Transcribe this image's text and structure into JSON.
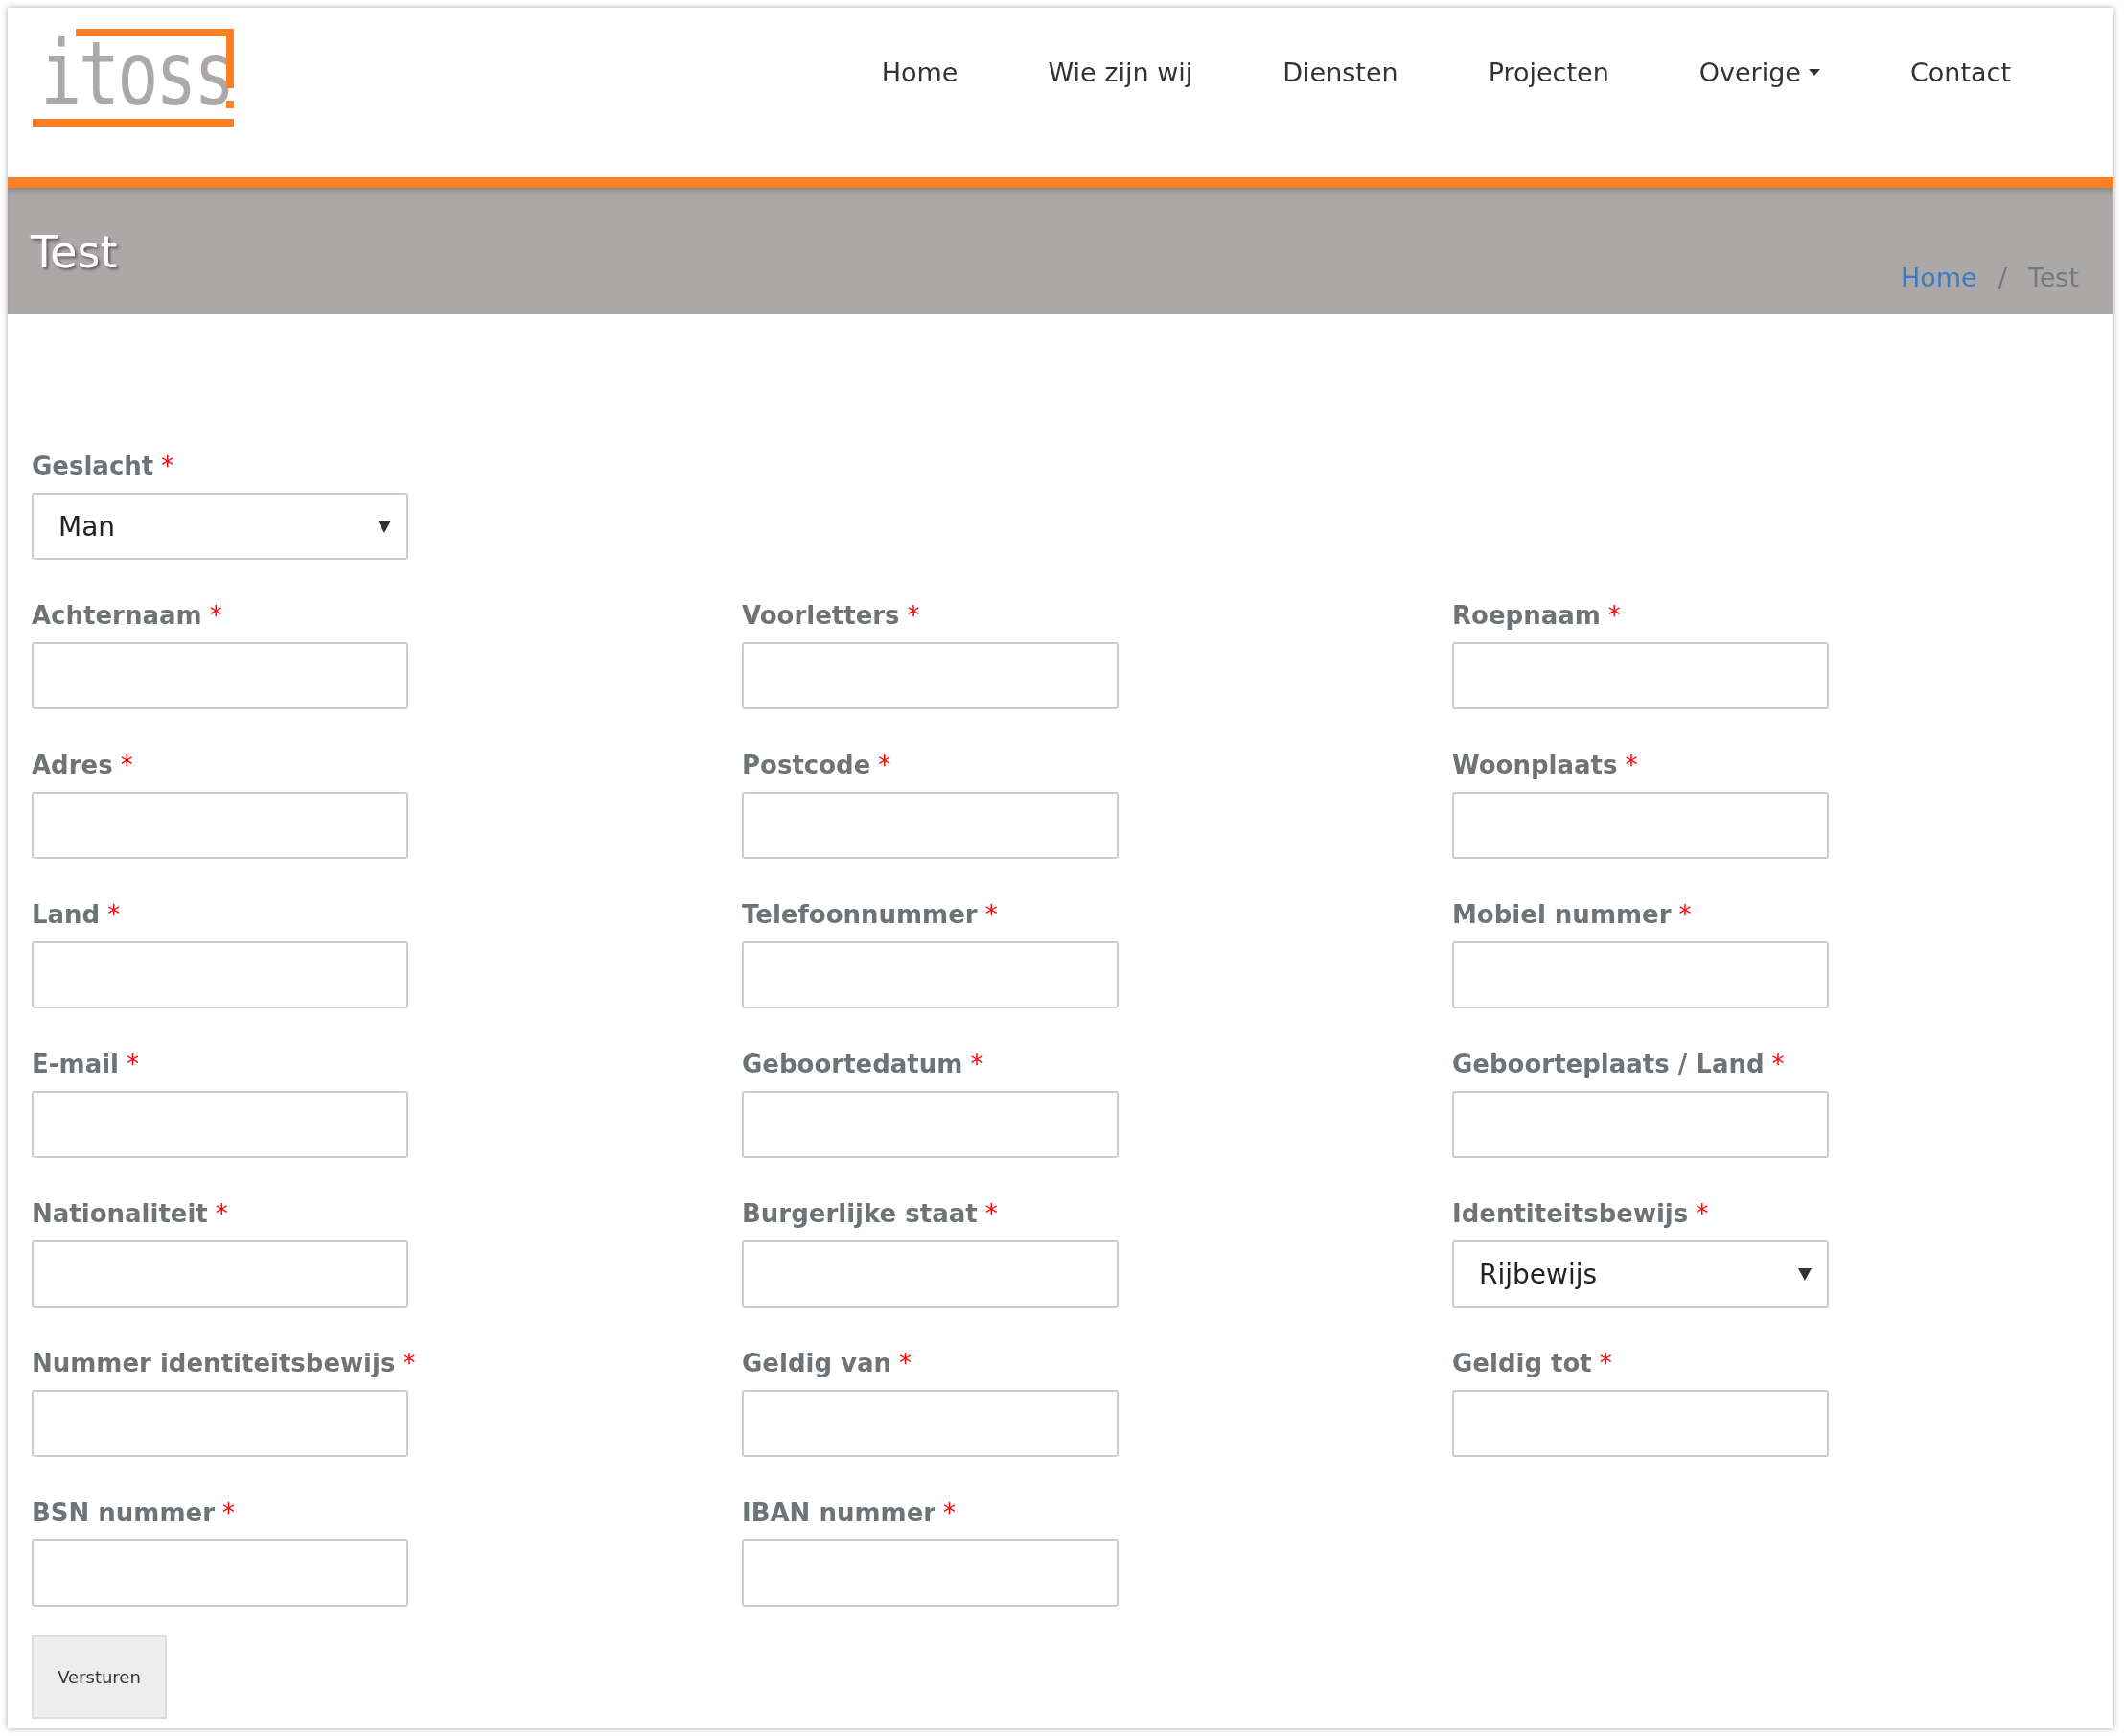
{
  "logo": {
    "text": "itoss"
  },
  "nav": [
    {
      "label": "Home",
      "dropdown": false
    },
    {
      "label": "Wie zijn wij",
      "dropdown": false
    },
    {
      "label": "Diensten",
      "dropdown": false
    },
    {
      "label": "Projecten",
      "dropdown": false
    },
    {
      "label": "Overige",
      "dropdown": true
    },
    {
      "label": "Contact",
      "dropdown": false
    }
  ],
  "banner": {
    "title": "Test",
    "breadcrumb": [
      {
        "label": "Home",
        "link": true
      },
      {
        "label": "Test",
        "link": false
      }
    ],
    "separator": "/"
  },
  "form": {
    "rows": [
      [
        {
          "label": "Geslacht",
          "required": true,
          "kind": "select",
          "value": "Man"
        }
      ],
      [
        {
          "label": "Achternaam",
          "required": true,
          "kind": "text"
        },
        {
          "label": "Voorletters",
          "required": true,
          "kind": "text"
        },
        {
          "label": "Roepnaam",
          "required": true,
          "kind": "text"
        }
      ],
      [
        {
          "label": "Adres",
          "required": true,
          "kind": "text"
        },
        {
          "label": "Postcode",
          "required": true,
          "kind": "text"
        },
        {
          "label": "Woonplaats",
          "required": true,
          "kind": "text"
        }
      ],
      [
        {
          "label": "Land",
          "required": true,
          "kind": "text"
        },
        {
          "label": "Telefoonnummer",
          "required": true,
          "kind": "text"
        },
        {
          "label": "Mobiel nummer",
          "required": true,
          "kind": "text"
        }
      ],
      [
        {
          "label": "E-mail",
          "required": true,
          "kind": "text"
        },
        {
          "label": "Geboortedatum",
          "required": true,
          "kind": "text"
        },
        {
          "label": "Geboorteplaats / Land",
          "required": true,
          "kind": "text"
        }
      ],
      [
        {
          "label": "Nationaliteit",
          "required": true,
          "kind": "text"
        },
        {
          "label": "Burgerlijke staat",
          "required": true,
          "kind": "text"
        },
        {
          "label": "Identiteitsbewijs",
          "required": true,
          "kind": "select",
          "value": "Rijbewijs"
        }
      ],
      [
        {
          "label": "Nummer identiteitsbewijs",
          "required": true,
          "kind": "text"
        },
        {
          "label": "Geldig van",
          "required": true,
          "kind": "text"
        },
        {
          "label": "Geldig tot",
          "required": true,
          "kind": "text"
        }
      ],
      [
        {
          "label": "BSN nummer",
          "required": true,
          "kind": "text"
        },
        {
          "label": "IBAN nummer",
          "required": true,
          "kind": "text"
        }
      ]
    ],
    "required_mark": "*",
    "submit": "Versturen"
  }
}
